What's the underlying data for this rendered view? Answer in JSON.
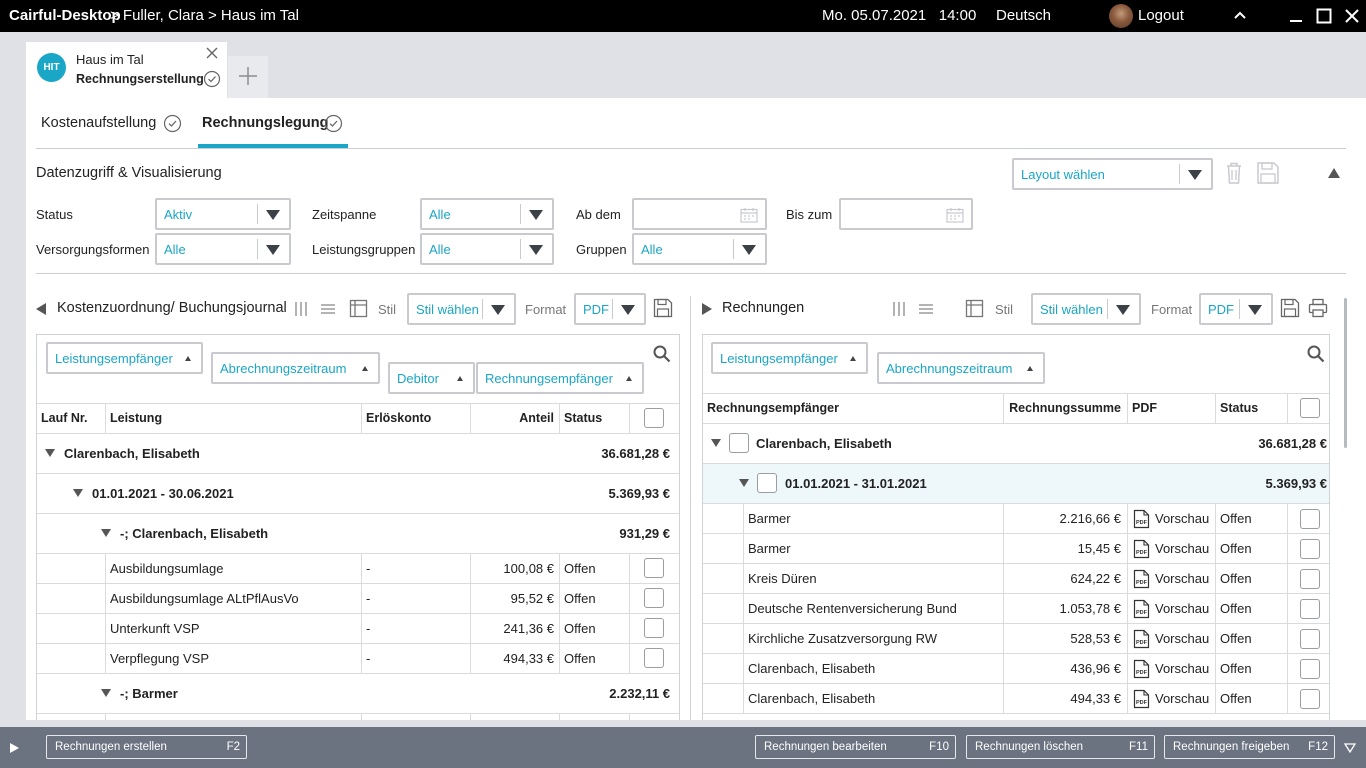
{
  "titlebar": {
    "app": "Cairful-Desktop",
    "path": " > Fuller, Clara > Haus im Tal",
    "datetime": "Mo. 05.07.2021   14:00",
    "language": "Deutsch",
    "logout": "Logout"
  },
  "doctab": {
    "avatar": "HIT",
    "title": "Haus im Tal",
    "subtitle": "Rechnungserstellung"
  },
  "subtabs": [
    {
      "label": "Kostenaufstellung"
    },
    {
      "label": "Rechnungslegung"
    }
  ],
  "filters": {
    "title": "Datenzugriff & Visualisierung",
    "layout_select": "Layout wählen",
    "status_label": "Status",
    "status_value": "Aktiv",
    "zeitspanne_label": "Zeitspanne",
    "zeitspanne_value": "Alle",
    "abdem_label": "Ab dem",
    "biszum_label": "Bis zum",
    "versorgung_label": "Versorgungsformen",
    "versorgung_value": "Alle",
    "leistungsgruppen_label": "Leistungsgruppen",
    "leistungsgruppen_value": "Alle",
    "gruppen_label": "Gruppen",
    "gruppen_value": "Alle"
  },
  "left": {
    "title": "Kostenzuordnung/ Buchungsjournal",
    "stil_label": "Stil",
    "stil_value": "Stil wählen",
    "format_label": "Format",
    "format_value": "PDF",
    "chips": [
      "Leistungsempfänger",
      "Abrechnungszeitraum",
      "Debitor",
      "Rechnungsempfänger"
    ],
    "columns": [
      "Lauf Nr.",
      "Leistung",
      "Erlöskonto",
      "Anteil",
      "Status"
    ],
    "group1": {
      "name": "Clarenbach, Elisabeth",
      "total": "36.681,28 €"
    },
    "group2": {
      "name": "01.01.2021 - 30.06.2021",
      "total": "5.369,93 €"
    },
    "group3": {
      "name": "-; Clarenbach, Elisabeth",
      "total": "931,29 €"
    },
    "rows": [
      {
        "leistung": "Ausbildungsumlage",
        "konto": "-",
        "anteil": "100,08 €",
        "status": "Offen"
      },
      {
        "leistung": "Ausbildungsumlage ALtPflAusVo",
        "konto": "-",
        "anteil": "95,52 €",
        "status": "Offen"
      },
      {
        "leistung": "Unterkunft VSP",
        "konto": "-",
        "anteil": "241,36 €",
        "status": "Offen"
      },
      {
        "leistung": "Verpflegung VSP",
        "konto": "-",
        "anteil": "494,33 €",
        "status": "Offen"
      }
    ],
    "group4": {
      "name": "-; Barmer",
      "total": "2.232,11 €"
    }
  },
  "right": {
    "title": "Rechnungen",
    "stil_label": "Stil",
    "stil_value": "Stil wählen",
    "format_label": "Format",
    "format_value": "PDF",
    "chips": [
      "Leistungsempfänger",
      "Abrechnungszeitraum"
    ],
    "columns": [
      "Rechnungsempfänger",
      "Rechnungssumme",
      "PDF",
      "Status"
    ],
    "group1": {
      "name": "Clarenbach, Elisabeth",
      "total": "36.681,28 €"
    },
    "group2": {
      "name": "01.01.2021 - 31.01.2021",
      "total": "5.369,93 €"
    },
    "rows": [
      {
        "name": "Barmer",
        "sum": "2.216,66 €",
        "pdf": "Vorschau",
        "status": "Offen"
      },
      {
        "name": "Barmer",
        "sum": "15,45 €",
        "pdf": "Vorschau",
        "status": "Offen"
      },
      {
        "name": "Kreis Düren",
        "sum": "624,22 €",
        "pdf": "Vorschau",
        "status": "Offen"
      },
      {
        "name": "Deutsche Rentenversicherung Bund",
        "sum": "1.053,78 €",
        "pdf": "Vorschau",
        "status": "Offen"
      },
      {
        "name": "Kirchliche Zusatzversorgung RW",
        "sum": "528,53 €",
        "pdf": "Vorschau",
        "status": "Offen"
      },
      {
        "name": "Clarenbach, Elisabeth",
        "sum": "436,96 €",
        "pdf": "Vorschau",
        "status": "Offen"
      },
      {
        "name": "Clarenbach, Elisabeth",
        "sum": "494,33 €",
        "pdf": "Vorschau",
        "status": "Offen"
      }
    ]
  },
  "bottombar": {
    "create": "Rechnungen erstellen",
    "create_key": "F2",
    "edit": "Rechnungen bearbeiten",
    "edit_key": "F10",
    "delete": "Rechnungen löschen",
    "delete_key": "F11",
    "release": "Rechnungen freigeben",
    "release_key": "F12"
  },
  "colors": {
    "accent": "#1aa6c7",
    "titlebar": "#000000",
    "bottombar": "#6b7280",
    "highlight_row": "#eef7f9"
  }
}
